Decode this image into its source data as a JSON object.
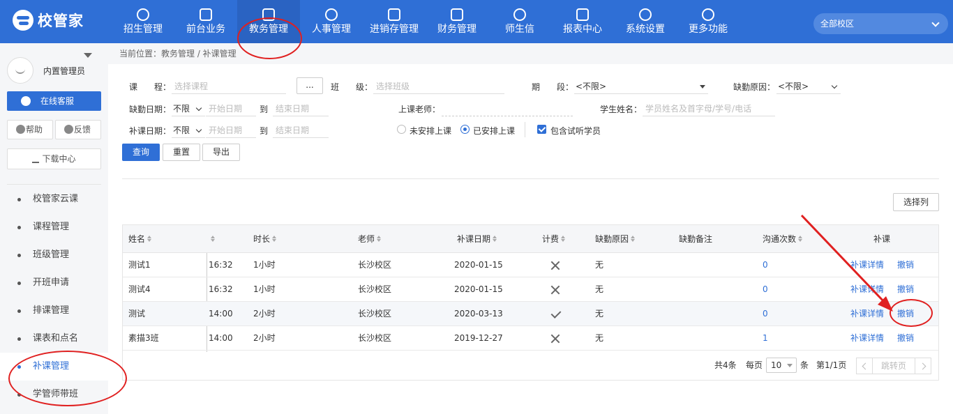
{
  "app": {
    "logo_text": "校管家"
  },
  "nav": [
    {
      "label": "招生管理",
      "icon": "person-add-icon"
    },
    {
      "label": "前台业务",
      "icon": "monitor-icon"
    },
    {
      "label": "教务管理",
      "icon": "book-icon"
    },
    {
      "label": "人事管理",
      "icon": "person-icon"
    },
    {
      "label": "进销存管理",
      "icon": "inventory-icon"
    },
    {
      "label": "财务管理",
      "icon": "money-bag-icon"
    },
    {
      "label": "师生信",
      "icon": "chat-icon"
    },
    {
      "label": "报表中心",
      "icon": "report-icon"
    },
    {
      "label": "系统设置",
      "icon": "settings-icon"
    },
    {
      "label": "更多功能",
      "icon": "more-icon"
    }
  ],
  "campus": {
    "label": "全部校区"
  },
  "sidebar": {
    "user_name": "内置管理员",
    "service_label": "在线客服",
    "help_label": "帮助",
    "feedback_label": "反馈",
    "download_label": "下载中心",
    "items": [
      {
        "label": "校管家云课"
      },
      {
        "label": "课程管理"
      },
      {
        "label": "班级管理"
      },
      {
        "label": "开班申请"
      },
      {
        "label": "排课管理"
      },
      {
        "label": "课表和点名"
      },
      {
        "label": "补课管理"
      },
      {
        "label": "学管师带班"
      }
    ]
  },
  "breadcrumb": "当前位置：教务管理 / 补课管理",
  "filters": {
    "course_label": "课　　程：",
    "course_placeholder": "选择课程",
    "dots_label": "...",
    "class_label": "班　　级：",
    "class_placeholder": "选择班级",
    "period_label": "期　　段：",
    "period_value": "<不限>",
    "absence_reason_label": "缺勤原因：",
    "absence_reason_value": "<不限>",
    "absence_date_label": "缺勤日期：",
    "absence_date_mode": "不限",
    "start_placeholder": "开始日期",
    "to_label": "到",
    "end_placeholder": "结束日期",
    "teacher_label": "上课老师：",
    "student_label": "学生姓名：",
    "student_placeholder": "学员姓名及首字母/学号/电话",
    "makeup_date_label": "补课日期：",
    "makeup_date_mode": "不限",
    "unscheduled_label": "未安排上课",
    "scheduled_label": "已安排上课",
    "include_trial_label": "包含试听学员"
  },
  "actions": {
    "query": "查询",
    "reset": "重置",
    "export": "导出",
    "select_columns": "选择列"
  },
  "table": {
    "headers": {
      "name": "姓名",
      "duration": "时长",
      "teacher": "老师",
      "makeup_date": "补课日期",
      "billing": "计费",
      "absence_reason": "缺勤原因",
      "absence_note": "缺勤备注",
      "contact_count": "沟通次数",
      "makeup": "补课"
    },
    "rows": [
      {
        "name": "测试1",
        "time": "16:32",
        "duration": "1小时",
        "teacher": "长沙校区",
        "date": "2020-01-15",
        "billing": "x",
        "reason": "无",
        "count": "0",
        "detail": "补课详情",
        "cancel": "撤销"
      },
      {
        "name": "测试4",
        "time": "16:32",
        "duration": "1小时",
        "teacher": "长沙校区",
        "date": "2020-01-15",
        "billing": "x",
        "reason": "无",
        "count": "0",
        "detail": "补课详情",
        "cancel": "撤销"
      },
      {
        "name": "测试",
        "time": "14:00",
        "duration": "2小时",
        "teacher": "长沙校区",
        "date": "2020-03-13",
        "billing": "check",
        "reason": "无",
        "count": "0",
        "detail": "补课详情",
        "cancel": "撤销"
      },
      {
        "name": "素描3班",
        "time": "14:00",
        "duration": "2小时",
        "teacher": "长沙校区",
        "date": "2019-12-27",
        "billing": "x",
        "reason": "无",
        "count": "1",
        "detail": "补课详情",
        "cancel": "撤销"
      }
    ]
  },
  "pager": {
    "total": "共4条",
    "per_page_label": "每页",
    "per_page": "10",
    "unit": "条",
    "page_info": "第1/1页",
    "jump": "跳转页"
  },
  "colors": {
    "primary": "#2f6fd6",
    "annotation": "#e02020"
  }
}
